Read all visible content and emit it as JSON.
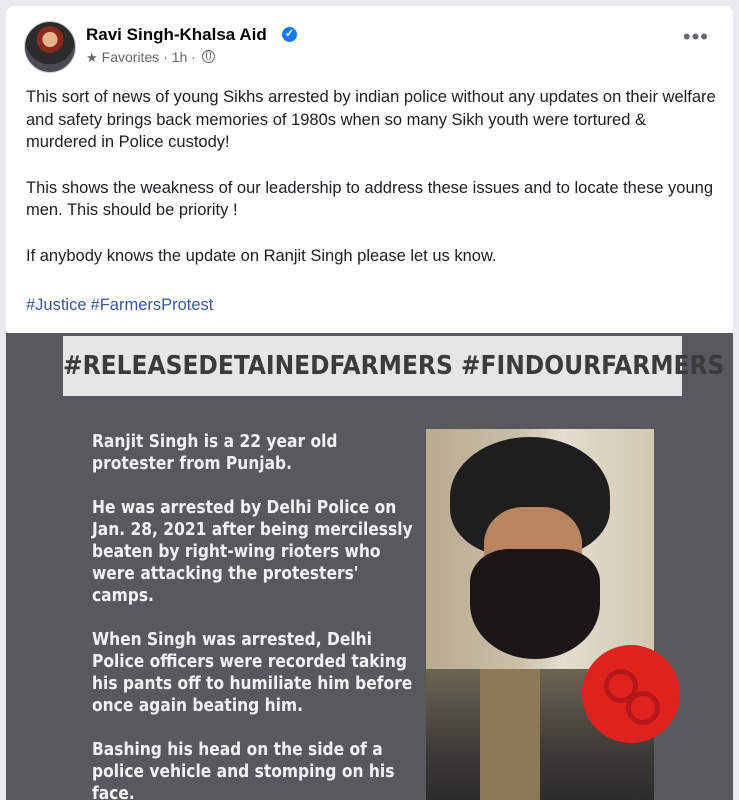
{
  "post": {
    "author": "Ravi Singh-Khalsa Aid",
    "favorites": "Favorites",
    "time": "1h",
    "separator": "·",
    "paragraphs": [
      "This sort of news of young Sikhs arrested by indian police without any updates on their welfare and safety brings back memories of 1980s when so many Sikh youth were tortured & murdered in Police custody!",
      "This shows the weakness of our leadership to address these issues and to locate these young men. This should be priority !",
      "If anybody knows the update on Ranjit Singh please let us know."
    ],
    "hashtags": [
      "#Justice",
      "#FarmersProtest"
    ]
  },
  "image": {
    "banner": "#RELEASEDETAINEDFARMERS #FINDOURFARMERS",
    "paragraphs": [
      "Ranjit Singh is a 22 year old protester from Punjab.",
      "He was arrested by Delhi Police on Jan. 28, 2021 after being mercilessly beaten by right-wing rioters who were attacking the protesters' camps.",
      "When Singh was arrested, Delhi Police officers were recorded taking his pants off to humiliate him before once again beating him.",
      "Bashing his head on the side of a police vehicle and stomping on his face."
    ]
  },
  "colors": {
    "link": "#385898",
    "verified": "#1877f2",
    "image_bg": "#58595d",
    "badge": "#e0221f"
  },
  "icons": [
    "verified-icon",
    "star-icon",
    "globe-icon",
    "more-icon",
    "handcuffs-icon"
  ]
}
